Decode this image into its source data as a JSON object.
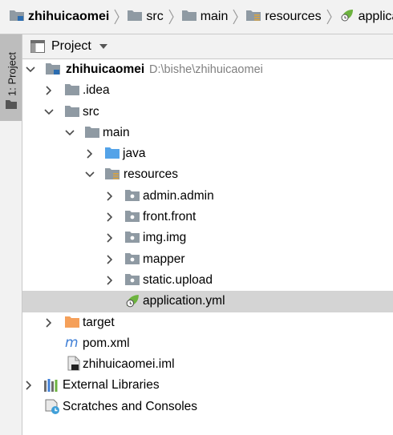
{
  "breadcrumb": {
    "items": [
      {
        "label": "zhihuicaomei",
        "icon": "module-folder-icon"
      },
      {
        "label": "src",
        "icon": "folder-icon"
      },
      {
        "label": "main",
        "icon": "folder-icon"
      },
      {
        "label": "resources",
        "icon": "resources-folder-icon"
      },
      {
        "label": "applicatio",
        "icon": "spring-config-icon"
      }
    ]
  },
  "side_strip": {
    "tab_label": "1: Project"
  },
  "panel": {
    "title": "Project"
  },
  "tree": {
    "root_name": "zhihuicaomei",
    "root_path": "D:\\bishe\\zhihuicaomei",
    "idea": ".idea",
    "src": "src",
    "main": "main",
    "java": "java",
    "resources": "resources",
    "admin": "admin.admin",
    "front": "front.front",
    "img": "img.img",
    "mapper": "mapper",
    "static": "static.upload",
    "application": "application.yml",
    "target": "target",
    "pom": "pom.xml",
    "iml": "zhihuicaomei.iml",
    "external": "External Libraries",
    "scratches": "Scratches and Consoles"
  },
  "colors": {
    "folder_grey": "#8f9aa3",
    "folder_blue": "#54a3e8",
    "folder_orange": "#f5a05a",
    "spring_green": "#6db33f",
    "selection": "#d4d4d4"
  }
}
